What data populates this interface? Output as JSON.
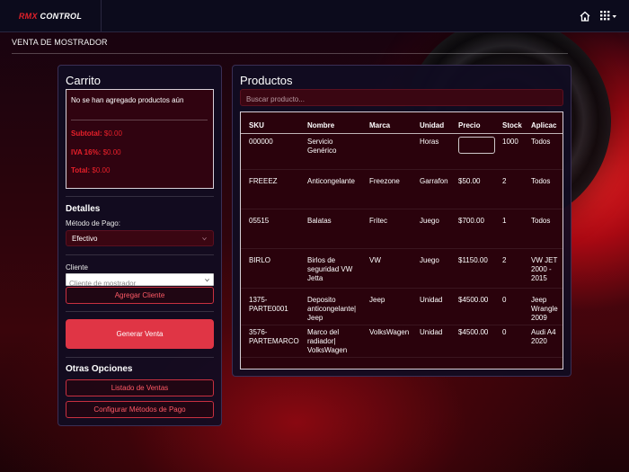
{
  "app": {
    "logo_part1": "RMX",
    "logo_part2": " CONTROL",
    "page_title": "VENTA DE MOSTRADOR",
    "home_icon": "home-icon",
    "apps_icon": "grid-icon",
    "accent": "#e03545"
  },
  "cart": {
    "title": "Carrito",
    "empty_text": "No se han agregado productos aún",
    "subtotal_label": "Subtotal:",
    "subtotal_value": "$0.00",
    "iva_label": "IVA 16%:",
    "iva_value": "$0.00",
    "total_label": "Total:",
    "total_value": "$0.00"
  },
  "details": {
    "title": "Detalles",
    "payment_label": "Método de Pago:",
    "payment_value": "Efectivo",
    "client_label": "Cliente",
    "client_placeholder": "Cliente de mostrador",
    "add_client": "Agregar Cliente",
    "generate_sale": "Generar Venta"
  },
  "other_options": {
    "title": "Otras Opciones",
    "sales_list": "Listado de Ventas",
    "config_payment": "Configurar Métodos de Pago"
  },
  "products": {
    "title": "Productos",
    "search_placeholder": "Buscar producto...",
    "columns": [
      "SKU",
      "Nombre",
      "Marca",
      "Unidad",
      "Precio",
      "Stock",
      "Aplicac"
    ],
    "rows": [
      {
        "sku": [
          "000000"
        ],
        "name": [
          "Servicio",
          "Genérico"
        ],
        "brand": [
          ""
        ],
        "unit": "Horas",
        "price": "",
        "stock": "1000",
        "app": [
          "Todos"
        ]
      },
      {
        "sku": [
          "FREEEZ"
        ],
        "name": [
          "Anticongelante"
        ],
        "brand": [
          "Freezone"
        ],
        "unit": "Garrafon",
        "price": "$50.00",
        "stock": "2",
        "app": [
          "Todos"
        ]
      },
      {
        "sku": [
          "05515"
        ],
        "name": [
          "Balatas"
        ],
        "brand": [
          "Fritec"
        ],
        "unit": "Juego",
        "price": "$700.00",
        "stock": "1",
        "app": [
          "Todos"
        ]
      },
      {
        "sku": [
          "BIRLO"
        ],
        "name": [
          "Birlos de",
          "seguridad VW",
          "Jetta"
        ],
        "brand": [
          "VW"
        ],
        "unit": "Juego",
        "price": "$1150.00",
        "stock": "2",
        "app": [
          "VW JET",
          "2000 -",
          "2015"
        ]
      },
      {
        "sku": [
          "1375-",
          "PARTE0001"
        ],
        "name": [
          "Deposito",
          "anticongelante|",
          "Jeep"
        ],
        "brand": [
          "Jeep"
        ],
        "unit": "Unidad",
        "price": "$4500.00",
        "stock": "0",
        "app": [
          "Jeep",
          "Wrangle",
          "2009"
        ]
      },
      {
        "sku": [
          "3576-",
          "PARTEMARCO"
        ],
        "name": [
          "Marco del",
          "radiador|",
          "VolksWagen"
        ],
        "brand": [
          "VolksWagen"
        ],
        "unit": "Unidad",
        "price": "$4500.00",
        "stock": "0",
        "app": [
          "Audi A4",
          "2020"
        ]
      }
    ]
  }
}
